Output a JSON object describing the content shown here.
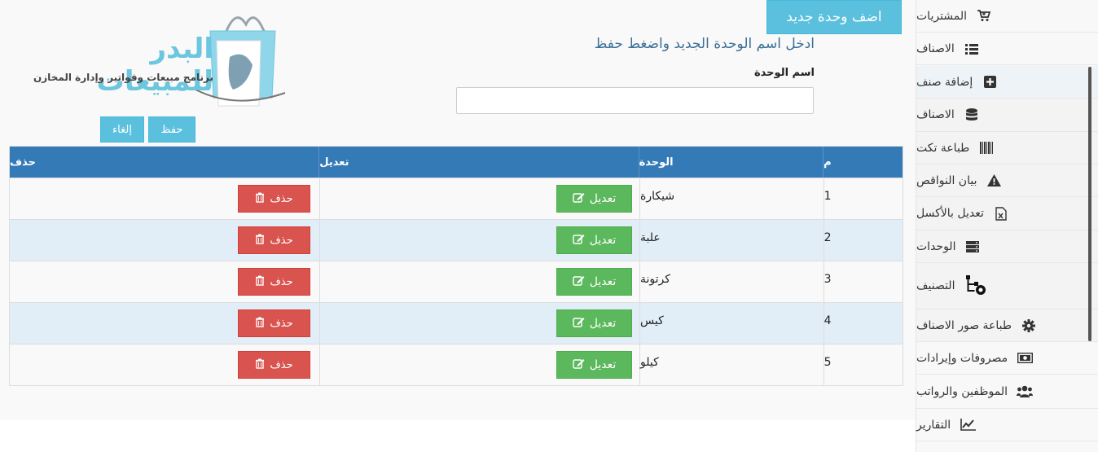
{
  "header": {
    "add_button": "اضف وحدة جديد",
    "instruction": "ادخل اسم الوحدة الجديد واضغط حفظ",
    "field_label": "اسم الوحدة",
    "input_value": "",
    "save_button": "حفظ",
    "cancel_button": "إلغاء"
  },
  "logo": {
    "title": "البدر للمبيعات",
    "subtitle": "برنامج مبيعات وفواتير وإدارة المخازن"
  },
  "table": {
    "headers": {
      "num": "م",
      "unit": "الوحدة",
      "edit": "تعديل",
      "delete": "حذف"
    },
    "edit_label": "تعديل",
    "delete_label": "حذف",
    "rows": [
      {
        "num": "1",
        "unit": "شيكارة"
      },
      {
        "num": "2",
        "unit": "علبة"
      },
      {
        "num": "3",
        "unit": "كرتونة"
      },
      {
        "num": "4",
        "unit": "كيس"
      },
      {
        "num": "5",
        "unit": "كيلو"
      }
    ]
  },
  "sidebar": {
    "items": [
      {
        "label": "المشتريات",
        "icon": "cart-icon"
      },
      {
        "label": "الاصناف",
        "icon": "list-icon"
      },
      {
        "label": "إضافة صنف",
        "icon": "plus-square-icon"
      },
      {
        "label": "الاصناف",
        "icon": "database-icon"
      },
      {
        "label": "طباعة تكت",
        "icon": "barcode-icon"
      },
      {
        "label": "بيان النواقص",
        "icon": "warning-icon"
      },
      {
        "label": "تعديل بالأكسل",
        "icon": "excel-file-icon"
      },
      {
        "label": "الوحدات",
        "icon": "server-icon"
      },
      {
        "label": "التصنيف",
        "icon": "category-gear-icon"
      },
      {
        "label": "طباعة صور الاصناف",
        "icon": "gear-icon"
      },
      {
        "label": "مصروفات وإيرادات",
        "icon": "money-icon"
      },
      {
        "label": "الموظفين والرواتب",
        "icon": "users-icon"
      },
      {
        "label": "التقارير",
        "icon": "chart-line-icon"
      }
    ]
  },
  "colors": {
    "accent": "#5bc0de",
    "table_header": "#337ab7",
    "edit": "#5cb85c",
    "delete": "#d9534f",
    "instruction": "#3a6f96"
  }
}
